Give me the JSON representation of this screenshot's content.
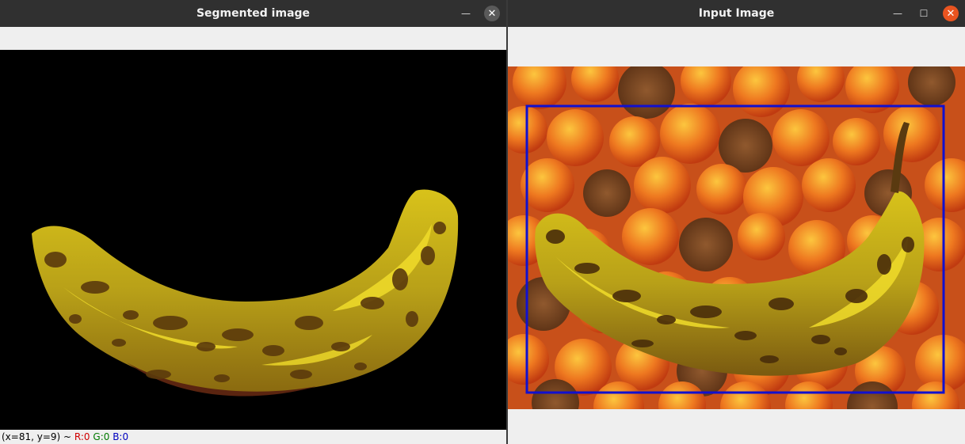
{
  "left_window": {
    "title": "Segmented image",
    "status": {
      "coords": "(x=81, y=9) ~",
      "r": "R:0",
      "g": "G:0",
      "b": "B:0"
    }
  },
  "right_window": {
    "title": "Input Image"
  },
  "colors": {
    "titlebar": "#303030",
    "close_accent": "#e95420",
    "bounding_box": "#1010d0"
  }
}
